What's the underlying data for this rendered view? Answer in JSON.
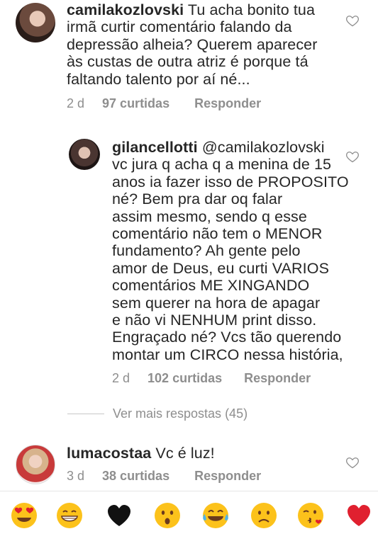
{
  "comments": [
    {
      "username": "camilakozlovski",
      "lines": [
        "Tu acha bonito tua",
        "irmã curtir comentário falando da",
        "depressão alheia? Querem aparecer",
        "às custas de outra atriz é porque tá",
        "faltando talento por aí né..."
      ],
      "time": "2 d",
      "likes": "97 curtidas",
      "reply": "Responder"
    },
    {
      "username": "gilancellotti",
      "mention": "@camilakozlovski",
      "lines": [
        "vc jura q acha q a menina de 15",
        "anos ia fazer isso de PROPOSITO",
        "né? Bem pra dar oq falar",
        "assim mesmo, sendo q esse",
        "comentário não tem o MENOR",
        "fundamento? Ah gente pelo",
        "amor de Deus, eu curti VARIOS",
        "comentários ME XINGANDO",
        "sem querer na hora de apagar",
        "e não vi NENHUM print disso.",
        "Engraçado né? Vcs tão querendo",
        "montar um CIRCO nessa história,"
      ],
      "time": "2 d",
      "likes": "102 curtidas",
      "reply": "Responder"
    },
    {
      "username": "lumacostaa",
      "lines": [
        "Vc é luz!"
      ],
      "time": "3 d",
      "likes": "38 curtidas",
      "reply": "Responder"
    }
  ],
  "more_replies": "Ver mais respostas (45)",
  "emoji_bar": [
    "heart-eyes-emoji",
    "grinning-emoji",
    "black-heart-emoji",
    "surprised-emoji",
    "tears-of-joy-emoji",
    "frowning-emoji",
    "kissing-emoji",
    "red-heart-emoji"
  ],
  "colors": {
    "text": "#262626",
    "secondary": "#8e8e8e",
    "emoji_yellow": "#fcc21b",
    "heart_red": "#e0202f"
  }
}
